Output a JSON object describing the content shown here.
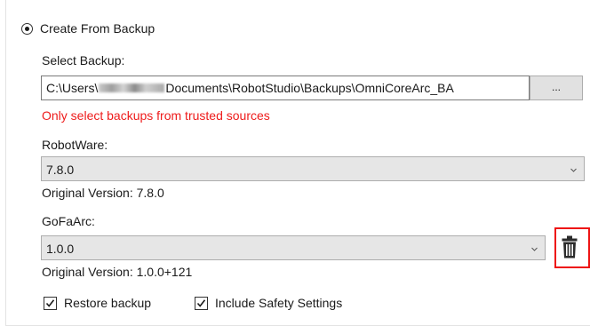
{
  "create_from_backup": {
    "label": "Create From Backup",
    "selected": true
  },
  "select_backup": {
    "label": "Select Backup:",
    "path_prefix": "C:\\Users\\",
    "path_suffix": "Documents\\RobotStudio\\Backups\\OmniCoreArc_BA",
    "browse_label": "...",
    "warning": "Only select backups from trusted sources"
  },
  "robotware": {
    "label": "RobotWare:",
    "selected_value": "7.8.0",
    "original_version": "Original Version: 7.8.0"
  },
  "gofaarc": {
    "label": "GoFaArc:",
    "selected_value": "1.0.0",
    "original_version": "Original Version: 1.0.0+121",
    "delete_icon": "trash-icon"
  },
  "options": {
    "restore_backup": {
      "label": "Restore backup",
      "checked": true
    },
    "include_safety": {
      "label": "Include Safety Settings",
      "checked": true
    }
  },
  "colors": {
    "warning": "#ee1b1b",
    "highlight_frame": "#ee1111",
    "dropdown_bg": "#e6e6e6"
  }
}
